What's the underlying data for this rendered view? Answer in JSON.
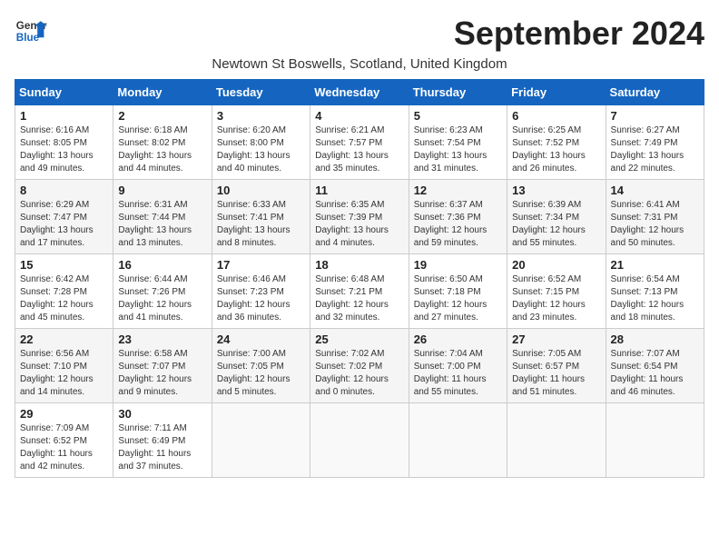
{
  "header": {
    "logo_general": "General",
    "logo_blue": "Blue",
    "month_title": "September 2024",
    "subtitle": "Newtown St Boswells, Scotland, United Kingdom"
  },
  "days_of_week": [
    "Sunday",
    "Monday",
    "Tuesday",
    "Wednesday",
    "Thursday",
    "Friday",
    "Saturday"
  ],
  "weeks": [
    [
      {
        "day": "1",
        "info": "Sunrise: 6:16 AM\nSunset: 8:05 PM\nDaylight: 13 hours and 49 minutes."
      },
      {
        "day": "2",
        "info": "Sunrise: 6:18 AM\nSunset: 8:02 PM\nDaylight: 13 hours and 44 minutes."
      },
      {
        "day": "3",
        "info": "Sunrise: 6:20 AM\nSunset: 8:00 PM\nDaylight: 13 hours and 40 minutes."
      },
      {
        "day": "4",
        "info": "Sunrise: 6:21 AM\nSunset: 7:57 PM\nDaylight: 13 hours and 35 minutes."
      },
      {
        "day": "5",
        "info": "Sunrise: 6:23 AM\nSunset: 7:54 PM\nDaylight: 13 hours and 31 minutes."
      },
      {
        "day": "6",
        "info": "Sunrise: 6:25 AM\nSunset: 7:52 PM\nDaylight: 13 hours and 26 minutes."
      },
      {
        "day": "7",
        "info": "Sunrise: 6:27 AM\nSunset: 7:49 PM\nDaylight: 13 hours and 22 minutes."
      }
    ],
    [
      {
        "day": "8",
        "info": "Sunrise: 6:29 AM\nSunset: 7:47 PM\nDaylight: 13 hours and 17 minutes."
      },
      {
        "day": "9",
        "info": "Sunrise: 6:31 AM\nSunset: 7:44 PM\nDaylight: 13 hours and 13 minutes."
      },
      {
        "day": "10",
        "info": "Sunrise: 6:33 AM\nSunset: 7:41 PM\nDaylight: 13 hours and 8 minutes."
      },
      {
        "day": "11",
        "info": "Sunrise: 6:35 AM\nSunset: 7:39 PM\nDaylight: 13 hours and 4 minutes."
      },
      {
        "day": "12",
        "info": "Sunrise: 6:37 AM\nSunset: 7:36 PM\nDaylight: 12 hours and 59 minutes."
      },
      {
        "day": "13",
        "info": "Sunrise: 6:39 AM\nSunset: 7:34 PM\nDaylight: 12 hours and 55 minutes."
      },
      {
        "day": "14",
        "info": "Sunrise: 6:41 AM\nSunset: 7:31 PM\nDaylight: 12 hours and 50 minutes."
      }
    ],
    [
      {
        "day": "15",
        "info": "Sunrise: 6:42 AM\nSunset: 7:28 PM\nDaylight: 12 hours and 45 minutes."
      },
      {
        "day": "16",
        "info": "Sunrise: 6:44 AM\nSunset: 7:26 PM\nDaylight: 12 hours and 41 minutes."
      },
      {
        "day": "17",
        "info": "Sunrise: 6:46 AM\nSunset: 7:23 PM\nDaylight: 12 hours and 36 minutes."
      },
      {
        "day": "18",
        "info": "Sunrise: 6:48 AM\nSunset: 7:21 PM\nDaylight: 12 hours and 32 minutes."
      },
      {
        "day": "19",
        "info": "Sunrise: 6:50 AM\nSunset: 7:18 PM\nDaylight: 12 hours and 27 minutes."
      },
      {
        "day": "20",
        "info": "Sunrise: 6:52 AM\nSunset: 7:15 PM\nDaylight: 12 hours and 23 minutes."
      },
      {
        "day": "21",
        "info": "Sunrise: 6:54 AM\nSunset: 7:13 PM\nDaylight: 12 hours and 18 minutes."
      }
    ],
    [
      {
        "day": "22",
        "info": "Sunrise: 6:56 AM\nSunset: 7:10 PM\nDaylight: 12 hours and 14 minutes."
      },
      {
        "day": "23",
        "info": "Sunrise: 6:58 AM\nSunset: 7:07 PM\nDaylight: 12 hours and 9 minutes."
      },
      {
        "day": "24",
        "info": "Sunrise: 7:00 AM\nSunset: 7:05 PM\nDaylight: 12 hours and 5 minutes."
      },
      {
        "day": "25",
        "info": "Sunrise: 7:02 AM\nSunset: 7:02 PM\nDaylight: 12 hours and 0 minutes."
      },
      {
        "day": "26",
        "info": "Sunrise: 7:04 AM\nSunset: 7:00 PM\nDaylight: 11 hours and 55 minutes."
      },
      {
        "day": "27",
        "info": "Sunrise: 7:05 AM\nSunset: 6:57 PM\nDaylight: 11 hours and 51 minutes."
      },
      {
        "day": "28",
        "info": "Sunrise: 7:07 AM\nSunset: 6:54 PM\nDaylight: 11 hours and 46 minutes."
      }
    ],
    [
      {
        "day": "29",
        "info": "Sunrise: 7:09 AM\nSunset: 6:52 PM\nDaylight: 11 hours and 42 minutes."
      },
      {
        "day": "30",
        "info": "Sunrise: 7:11 AM\nSunset: 6:49 PM\nDaylight: 11 hours and 37 minutes."
      },
      {
        "day": "",
        "info": ""
      },
      {
        "day": "",
        "info": ""
      },
      {
        "day": "",
        "info": ""
      },
      {
        "day": "",
        "info": ""
      },
      {
        "day": "",
        "info": ""
      }
    ]
  ]
}
